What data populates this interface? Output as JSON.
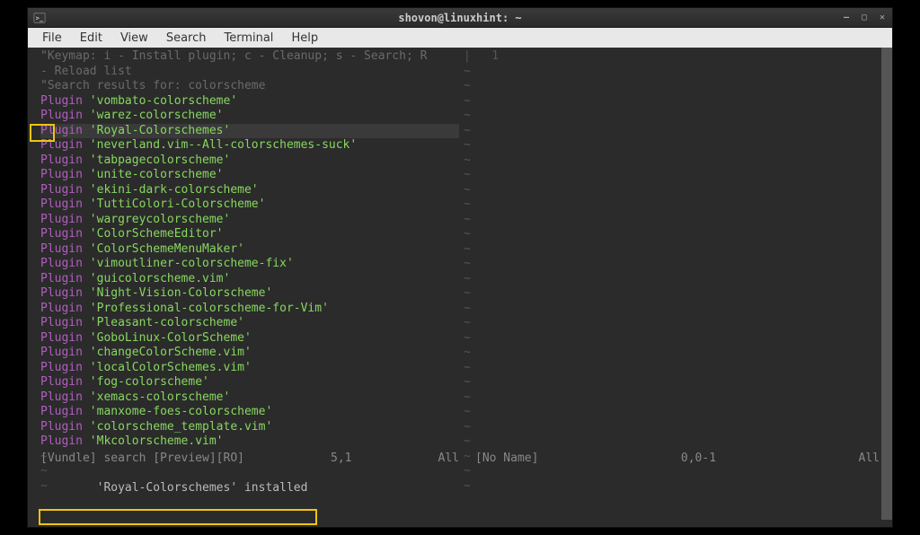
{
  "window": {
    "title": "shovon@linuxhint: ~"
  },
  "menubar": [
    "File",
    "Edit",
    "View",
    "Search",
    "Terminal",
    "Help"
  ],
  "header": {
    "keymap_prefix": "\"Keymap:",
    "keymap_rest": " i - Install plugin; c - Cleanup; s - Search; R",
    "reload": "- Reload list",
    "search_prefix": "\"Search results for: colorscheme"
  },
  "plugins": [
    "vombato-colorscheme",
    "warez-colorscheme",
    "Royal-Colorschemes",
    "neverland.vim--All-colorschemes-suck",
    "tabpagecolorscheme",
    "unite-colorscheme",
    "ekini-dark-colorscheme",
    "TuttiColori-Colorscheme",
    "wargreycolorscheme",
    "ColorSchemeEditor",
    "ColorSchemeMenuMaker",
    "vimoutliner-colorscheme-fix",
    "guicolorscheme.vim",
    "Night-Vision-Colorscheme",
    "Professional-colorscheme-for-Vim",
    "Pleasant-colorscheme",
    "GoboLinux-ColorScheme",
    "changeColorScheme.vim",
    "localColorSchemes.vim",
    "fog-colorscheme",
    "xemacs-colorscheme",
    "manxome-foes-colorscheme",
    "colorscheme_template.vim",
    "Mkcolorscheme.vim"
  ],
  "highlighted_index": 2,
  "status_left": {
    "name": "[Vundle] search [Preview][RO]",
    "pos": "5,1",
    "pct": "All"
  },
  "status_right": {
    "name": "[No Name]",
    "pos": "0,0-1",
    "pct": "All"
  },
  "right_pane_col1": "|   1",
  "cmdline": "'Royal-Colorschemes' installed"
}
